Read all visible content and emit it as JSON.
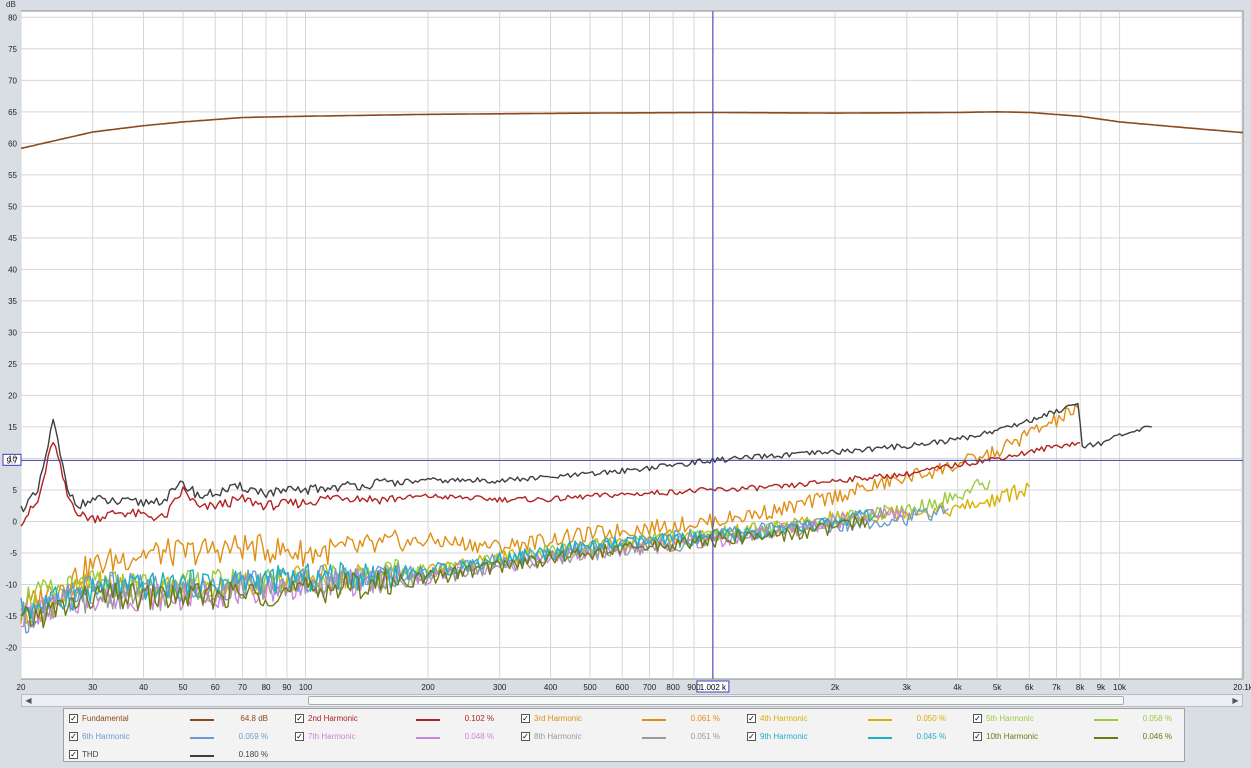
{
  "chart_data": {
    "type": "line",
    "title": "",
    "xlabel": "",
    "ylabel": "dB",
    "x_scale": "log",
    "xlim": [
      20,
      20100
    ],
    "ylim": [
      -25,
      81
    ],
    "grid": true,
    "x_tick_labels": [
      {
        "f": 20,
        "label": "20"
      },
      {
        "f": 30,
        "label": "30"
      },
      {
        "f": 40,
        "label": "40"
      },
      {
        "f": 50,
        "label": "50"
      },
      {
        "f": 60,
        "label": "60"
      },
      {
        "f": 70,
        "label": "70"
      },
      {
        "f": 80,
        "label": "80"
      },
      {
        "f": 90,
        "label": "90"
      },
      {
        "f": 100,
        "label": "100"
      },
      {
        "f": 200,
        "label": "200"
      },
      {
        "f": 300,
        "label": "300"
      },
      {
        "f": 400,
        "label": "400"
      },
      {
        "f": 500,
        "label": "500"
      },
      {
        "f": 600,
        "label": "600"
      },
      {
        "f": 700,
        "label": "700"
      },
      {
        "f": 800,
        "label": "800"
      },
      {
        "f": 900,
        "label": "900"
      },
      {
        "f": 2000,
        "label": "2k"
      },
      {
        "f": 3000,
        "label": "3k"
      },
      {
        "f": 4000,
        "label": "4k"
      },
      {
        "f": 5000,
        "label": "5k"
      },
      {
        "f": 6000,
        "label": "6k"
      },
      {
        "f": 7000,
        "label": "7k"
      },
      {
        "f": 8000,
        "label": "8k"
      },
      {
        "f": 9000,
        "label": "9k"
      },
      {
        "f": 10000,
        "label": "10k"
      },
      {
        "f": 20100,
        "label": "20.1k"
      }
    ],
    "y_tick_labels": [
      {
        "v": 80,
        "label": "80"
      },
      {
        "v": 75,
        "label": "75"
      },
      {
        "v": 70,
        "label": "70"
      },
      {
        "v": 65,
        "label": "65"
      },
      {
        "v": 60,
        "label": "60"
      },
      {
        "v": 55,
        "label": "55"
      },
      {
        "v": 50,
        "label": "50"
      },
      {
        "v": 45,
        "label": "45"
      },
      {
        "v": 40,
        "label": "40"
      },
      {
        "v": 35,
        "label": "35"
      },
      {
        "v": 30,
        "label": "30"
      },
      {
        "v": 25,
        "label": "25"
      },
      {
        "v": 20,
        "label": "20"
      },
      {
        "v": 15,
        "label": "15"
      },
      {
        "v": 10,
        "label": "10"
      },
      {
        "v": 5,
        "label": "5"
      },
      {
        "v": 0,
        "label": "0"
      },
      {
        "v": -5,
        "label": "-5"
      },
      {
        "v": -10,
        "label": "-10"
      },
      {
        "v": -15,
        "label": "-15"
      },
      {
        "v": -20,
        "label": "-20"
      }
    ],
    "cursor": {
      "x": 1002,
      "y": 9.7,
      "x_label": "1.002 k",
      "y_label": "9.7",
      "color": "#3d3db3"
    },
    "series": [
      {
        "name": "Fundamental",
        "color": "#8b4a1c",
        "value_label": "64.8 dB",
        "x": [
          20,
          30,
          40,
          50,
          70,
          100,
          200,
          500,
          1000,
          2000,
          4000,
          5000,
          6000,
          8000,
          10000,
          15000,
          20100
        ],
        "y": [
          59.2,
          61.8,
          62.8,
          63.4,
          64.1,
          64.3,
          64.6,
          64.8,
          64.9,
          64.8,
          64.9,
          65.0,
          64.9,
          64.3,
          63.4,
          62.4,
          61.7
        ]
      },
      {
        "name": "2nd Harmonic",
        "color": "#b22222",
        "value_label": "0.102 %",
        "x": [
          20,
          22,
          24,
          26,
          28,
          30,
          35,
          40,
          45,
          50,
          55,
          60,
          70,
          80,
          100,
          120,
          150,
          200,
          300,
          400,
          500,
          700,
          1000,
          1500,
          2000,
          3000,
          4000,
          5000,
          6000,
          7000,
          8000
        ],
        "y": [
          0,
          3,
          13,
          4,
          1,
          0.5,
          1.5,
          1.0,
          0.5,
          5,
          2,
          2.5,
          3.5,
          2.5,
          3,
          4,
          3.5,
          4,
          3.5,
          3.5,
          4,
          4.5,
          5,
          5.5,
          6.5,
          7.5,
          9,
          10,
          11,
          12,
          12.5
        ]
      },
      {
        "name": "3rd Harmonic",
        "color": "#e08f14",
        "value_label": "0.061 %",
        "x": [
          20,
          30,
          40,
          50,
          70,
          100,
          150,
          200,
          300,
          500,
          700,
          1000,
          1500,
          2000,
          3000,
          4000,
          5000,
          6000,
          7000,
          7900
        ],
        "y": [
          -14,
          -7,
          -5,
          -5,
          -4,
          -5,
          -4,
          -3,
          -4,
          -2,
          -1,
          0,
          2,
          4,
          7,
          9,
          11,
          14,
          16,
          18
        ]
      },
      {
        "name": "4th Harmonic",
        "color": "#d9b000",
        "value_label": "0.050 %",
        "x": [
          20,
          30,
          50,
          100,
          200,
          300,
          500,
          1000,
          1500,
          2000,
          3000,
          4000,
          5000,
          6000
        ],
        "y": [
          -15,
          -10,
          -11,
          -9,
          -8,
          -6,
          -4,
          -2,
          -1,
          0.5,
          1.5,
          2,
          3.5,
          5.5
        ]
      },
      {
        "name": "5th Harmonic",
        "color": "#9ccc3c",
        "value_label": "0.058 %",
        "x": [
          20,
          30,
          50,
          100,
          200,
          300,
          500,
          1000,
          1500,
          2000,
          3000,
          4000,
          4800
        ],
        "y": [
          -12,
          -10,
          -10,
          -9,
          -8,
          -6,
          -4,
          -2,
          -1,
          0.5,
          2,
          4,
          6.5
        ]
      },
      {
        "name": "6th Harmonic",
        "color": "#6c9bd2",
        "value_label": "0.059 %",
        "x": [
          20,
          30,
          50,
          100,
          200,
          300,
          500,
          1000,
          1500,
          2000,
          3000,
          3800
        ],
        "y": [
          -16,
          -10,
          -11,
          -9,
          -8,
          -6,
          -4,
          -2,
          -1,
          -0.5,
          0.5,
          2
        ]
      },
      {
        "name": "7th Harmonic",
        "color": "#cc84e0",
        "value_label": "0.048 %",
        "x": [
          20,
          30,
          50,
          100,
          200,
          300,
          500,
          1000,
          1500,
          2000,
          3000
        ],
        "y": [
          -15,
          -12,
          -12,
          -10,
          -9,
          -7,
          -5,
          -3,
          -1.5,
          0,
          1.5
        ]
      },
      {
        "name": "8th Harmonic",
        "color": "#9a9a9a",
        "value_label": "0.051 %",
        "x": [
          20,
          30,
          50,
          100,
          200,
          300,
          500,
          1000,
          1500,
          2000,
          2700
        ],
        "y": [
          -15,
          -12,
          -11,
          -10,
          -9,
          -7,
          -5,
          -3,
          -1.5,
          0,
          1.5
        ]
      },
      {
        "name": "9th Harmonic",
        "color": "#1ab0c6",
        "value_label": "0.045 %",
        "x": [
          20,
          30,
          50,
          100,
          200,
          300,
          500,
          1000,
          1500,
          2000,
          2500
        ],
        "y": [
          -14,
          -11,
          -10,
          -9,
          -8,
          -6,
          -4,
          -2.5,
          -1.5,
          0,
          1
        ]
      },
      {
        "name": "10th Harmonic",
        "color": "#6e7a10",
        "value_label": "0.046 %",
        "x": [
          20,
          30,
          50,
          100,
          200,
          300,
          500,
          1000,
          1500,
          2000,
          2400
        ],
        "y": [
          -16,
          -12,
          -12,
          -11,
          -9,
          -7,
          -5,
          -3,
          -2,
          -1,
          0
        ]
      },
      {
        "name": "THD",
        "color": "#3f3f3f",
        "value_label": "0.180 %",
        "x": [
          20,
          22,
          24,
          26,
          28,
          30,
          35,
          40,
          45,
          50,
          55,
          60,
          70,
          80,
          100,
          120,
          150,
          200,
          300,
          400,
          500,
          700,
          1000,
          1500,
          2000,
          3000,
          4000,
          5000,
          6000,
          7000,
          7900,
          8100,
          9000,
          10000,
          12000
        ],
        "y": [
          2,
          4.5,
          16,
          5,
          2.5,
          3.5,
          3,
          3,
          3.5,
          6,
          4,
          4.5,
          5.5,
          4.5,
          5,
          5.5,
          6,
          6.5,
          6.5,
          7,
          7.5,
          8.5,
          9.7,
          10.5,
          11,
          12,
          13,
          14.5,
          16,
          17.5,
          19,
          12,
          12.5,
          13.5,
          15
        ]
      }
    ]
  },
  "legend": [
    {
      "name": "Fundamental",
      "value": "64.8 dB",
      "color": "#8b4a1c",
      "checked": "✓"
    },
    {
      "name": "2nd Harmonic",
      "value": "0.102 %",
      "color": "#b22222",
      "checked": "✓"
    },
    {
      "name": "3rd Harmonic",
      "value": "0.061 %",
      "color": "#e08f14",
      "checked": "✓"
    },
    {
      "name": "4th Harmonic",
      "value": "0.050 %",
      "color": "#d9b000",
      "checked": "✓"
    },
    {
      "name": "5th Harmonic",
      "value": "0.058 %",
      "color": "#9ccc3c",
      "checked": "✓"
    },
    {
      "name": "6th Harmonic",
      "value": "0.059 %",
      "color": "#6c9bd2",
      "checked": "✓"
    },
    {
      "name": "7th Harmonic",
      "value": "0.048 %",
      "color": "#cc84e0",
      "checked": "✓"
    },
    {
      "name": "8th Harmonic",
      "value": "0.051 %",
      "color": "#9a9a9a",
      "checked": "✓"
    },
    {
      "name": "9th Harmonic",
      "value": "0.045 %",
      "color": "#1ab0c6",
      "checked": "✓"
    },
    {
      "name": "10th Harmonic",
      "value": "0.046 %",
      "color": "#6e7a10",
      "checked": "✓"
    },
    {
      "name": "THD",
      "value": "0.180 %",
      "color": "#3f3f3f",
      "checked": "✓"
    }
  ],
  "scrollbar": {
    "left_arrow": "◀",
    "right_arrow": "▶"
  }
}
